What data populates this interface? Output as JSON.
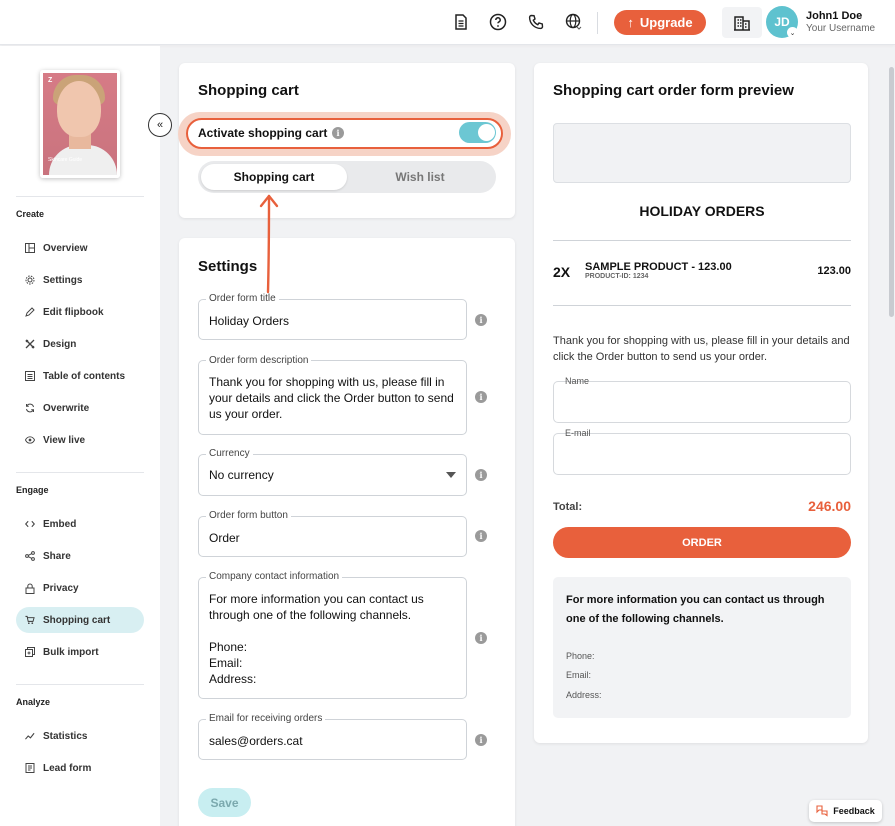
{
  "topbar": {
    "icons": [
      "document-icon",
      "help-icon",
      "phone-icon",
      "globe-icon"
    ],
    "upgrade_label": "Upgrade",
    "user": {
      "initials": "JD",
      "name": "John1 Doe",
      "username": "Your Username"
    }
  },
  "sidebar": {
    "thumbnail": {
      "logo": "Z",
      "caption": "Skincare Guide"
    },
    "sections": [
      {
        "title": "Create",
        "items": [
          {
            "label": "Overview",
            "icon": "overview-icon"
          },
          {
            "label": "Settings",
            "icon": "gear-icon"
          },
          {
            "label": "Edit flipbook",
            "icon": "pencil-icon"
          },
          {
            "label": "Design",
            "icon": "palette-icon"
          },
          {
            "label": "Table of contents",
            "icon": "list-icon"
          },
          {
            "label": "Overwrite",
            "icon": "refresh-icon"
          },
          {
            "label": "View live",
            "icon": "eye-icon"
          }
        ]
      },
      {
        "title": "Engage",
        "items": [
          {
            "label": "Embed",
            "icon": "code-icon"
          },
          {
            "label": "Share",
            "icon": "share-icon"
          },
          {
            "label": "Privacy",
            "icon": "lock-icon"
          },
          {
            "label": "Shopping cart",
            "icon": "cart-icon",
            "active": true
          },
          {
            "label": "Bulk import",
            "icon": "import-icon"
          }
        ]
      },
      {
        "title": "Analyze",
        "items": [
          {
            "label": "Statistics",
            "icon": "chart-icon"
          },
          {
            "label": "Lead form",
            "icon": "form-icon"
          }
        ]
      }
    ]
  },
  "cart_card": {
    "title": "Shopping cart",
    "activate_label": "Activate shopping cart",
    "activated": true,
    "tabs": [
      "Shopping cart",
      "Wish list"
    ],
    "active_tab": "Shopping cart"
  },
  "settings": {
    "title": "Settings",
    "fields": [
      {
        "label": "Order form title",
        "value": "Holiday Orders"
      },
      {
        "label": "Order form description",
        "value": "Thank you for shopping with us, please fill in\nyour details and click the Order button to send\nus your order."
      },
      {
        "label": "Currency",
        "value": "No currency"
      },
      {
        "label": "Order form button",
        "value": "Order"
      },
      {
        "label": "Company contact information",
        "value": "For more information you can contact us\nthrough one of the following channels.\n\nPhone:\nEmail:\nAddress:"
      },
      {
        "label": "Email for receiving orders",
        "value": "sales@orders.cat"
      }
    ],
    "save_label": "Save"
  },
  "preview": {
    "title": "Shopping cart order form preview",
    "heading": "HOLIDAY ORDERS",
    "item": {
      "qty": "2X",
      "name": "SAMPLE PRODUCT -  123.00",
      "product_id": "PRODUCT-ID: 1234",
      "price": "123.00"
    },
    "description": "Thank you for shopping with us, please fill in your details and click the Order button to send us your order.",
    "name_label": "Name",
    "email_label": "E-mail",
    "total_label": "Total:",
    "total_value": "246.00",
    "order_button": "ORDER",
    "contact_title": "For more information you can contact us through one of the following channels.",
    "contact_lines": [
      "Phone:",
      "Email:",
      "Address:"
    ]
  },
  "feedback_label": "Feedback",
  "colors": {
    "accent": "#e8603c",
    "teal": "#6cc7d3",
    "active_nav": "#d8eff2"
  }
}
